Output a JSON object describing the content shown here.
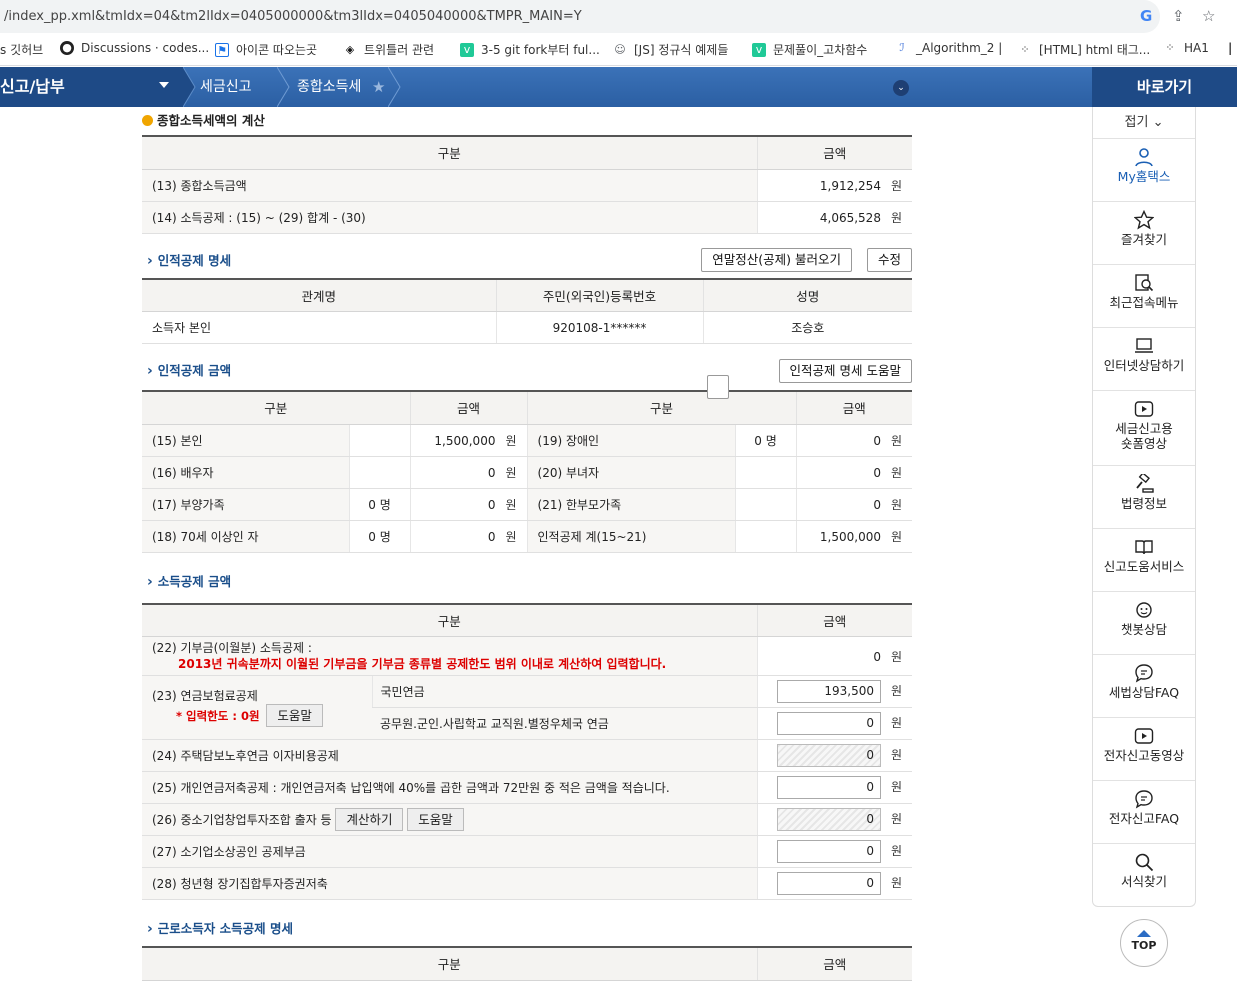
{
  "browser": {
    "url": "/index_pp.xml&tmIdx=04&tm2lIdx=0405000000&tm3lIdx=0405040000&TMPR_MAIN=Y",
    "bookmarks": [
      "s 깃허브",
      "Discussions · codes...",
      "아이콘 따오는곳",
      "트위틀러 관련",
      "3-5 git fork부터 ful...",
      "[JS] 정규식 예제들",
      "문제풀이_고차함수",
      "_Algorithm_2 |",
      "[HTML] html 태그...",
      "HA1"
    ]
  },
  "gnb": {
    "menu": "신고/납부",
    "crumb1": "세금신고",
    "crumb2": "종합소득세"
  },
  "quick": {
    "title": "바로가기",
    "fold": "접기",
    "items": [
      {
        "label": "My홈택스",
        "icon": "person-icon"
      },
      {
        "label": "즐겨찾기",
        "icon": "star-icon"
      },
      {
        "label": "최근접속메뉴",
        "icon": "recent-search-icon"
      },
      {
        "label": "인터넷상담하기",
        "icon": "laptop-icon"
      },
      {
        "label": "세금신고용\n숏폼영상",
        "icon": "video-icon"
      },
      {
        "label": "법령정보",
        "icon": "gavel-icon"
      },
      {
        "label": "신고도움서비스",
        "icon": "book-icon"
      },
      {
        "label": "챗봇상담",
        "icon": "headset-icon"
      },
      {
        "label": "세법상담FAQ",
        "icon": "chat-icon"
      },
      {
        "label": "전자신고동영상",
        "icon": "video-icon"
      },
      {
        "label": "전자신고FAQ",
        "icon": "chat-icon"
      },
      {
        "label": "서식찾기",
        "icon": "search-icon"
      }
    ],
    "top": "TOP"
  },
  "calc": {
    "title": "종합소득세액의 계산",
    "col1": "구분",
    "col2": "금액",
    "rows": [
      {
        "label": "(13) 종합소득금액",
        "value": "1,912,254",
        "unit": "원"
      },
      {
        "label": "(14) 소득공제 : (15) ~ (29) 합계 - (30)",
        "value": "4,065,528",
        "unit": "원"
      }
    ]
  },
  "personal_list": {
    "title": "인적공제 명세",
    "btn_load": "연말정산(공제) 불러오기",
    "btn_edit": "수정",
    "cols": [
      "관계명",
      "주민(외국인)등록번호",
      "성명"
    ],
    "rows": [
      {
        "rel": "소득자 본인",
        "id": "920108-1******",
        "name": "조승호"
      }
    ]
  },
  "personal_amount": {
    "title": "인적공제 금액",
    "btn_help": "인적공제 명세 도움말",
    "cols": [
      "구분",
      "금액",
      "구분",
      "금액"
    ],
    "rows": [
      {
        "l": "(15) 본인",
        "lc": "",
        "lv": "1,500,000",
        "r": "(19) 장애인",
        "rc": "0 명",
        "rv": "0"
      },
      {
        "l": "(16) 배우자",
        "lc": "",
        "lv": "0",
        "r": "(20) 부녀자",
        "rc": "",
        "rv": "0"
      },
      {
        "l": "(17) 부양가족",
        "lc": "0 명",
        "lv": "0",
        "r": "(21) 한부모가족",
        "rc": "",
        "rv": "0"
      },
      {
        "l": "(18) 70세 이상인 자",
        "lc": "0 명",
        "lv": "0",
        "r": "인적공제 계(15~21)",
        "rc": "",
        "rv": "1,500,000"
      }
    ],
    "unit": "원"
  },
  "income_deduct": {
    "title": "소득공제 금액",
    "col1": "구분",
    "col2": "금액",
    "unit": "원",
    "r22": {
      "label": "(22) 기부금(이월분) 소득공제 :",
      "note": "2013년 귀속분까지 이월된 기부금을 기부금 종류별 공제한도 범위 이내로 계산하여 입력합니다.",
      "value": "0"
    },
    "r23": {
      "label": "(23) 연금보험료공제",
      "limit": "* 입력한도 : 0원",
      "btn": "도움말",
      "sub1": "국민연금",
      "v1": "193,500",
      "sub2": "공무원.군인.사립학교 교직원.별정우체국 연금",
      "v2": "0"
    },
    "r24": {
      "label": "(24) 주택담보노후연금 이자비용공제",
      "value": "0"
    },
    "r25": {
      "label": "(25) 개인연금저축공제 : 개인연금저축 납입액에 40%를 곱한 금액과 72만원 중 적은 금액을 적습니다.",
      "value": "0"
    },
    "r26": {
      "label": "(26) 중소기업창업투자조합 출자 등",
      "btn1": "계산하기",
      "btn2": "도움말",
      "value": "0"
    },
    "r27": {
      "label": "(27) 소기업소상공인 공제부금",
      "value": "0"
    },
    "r28": {
      "label": "(28) 청년형 장기집합투자증권저축",
      "value": "0"
    }
  },
  "worker": {
    "title": "근로소득자 소득공제 명세",
    "col1": "구분",
    "col2": "금액"
  }
}
